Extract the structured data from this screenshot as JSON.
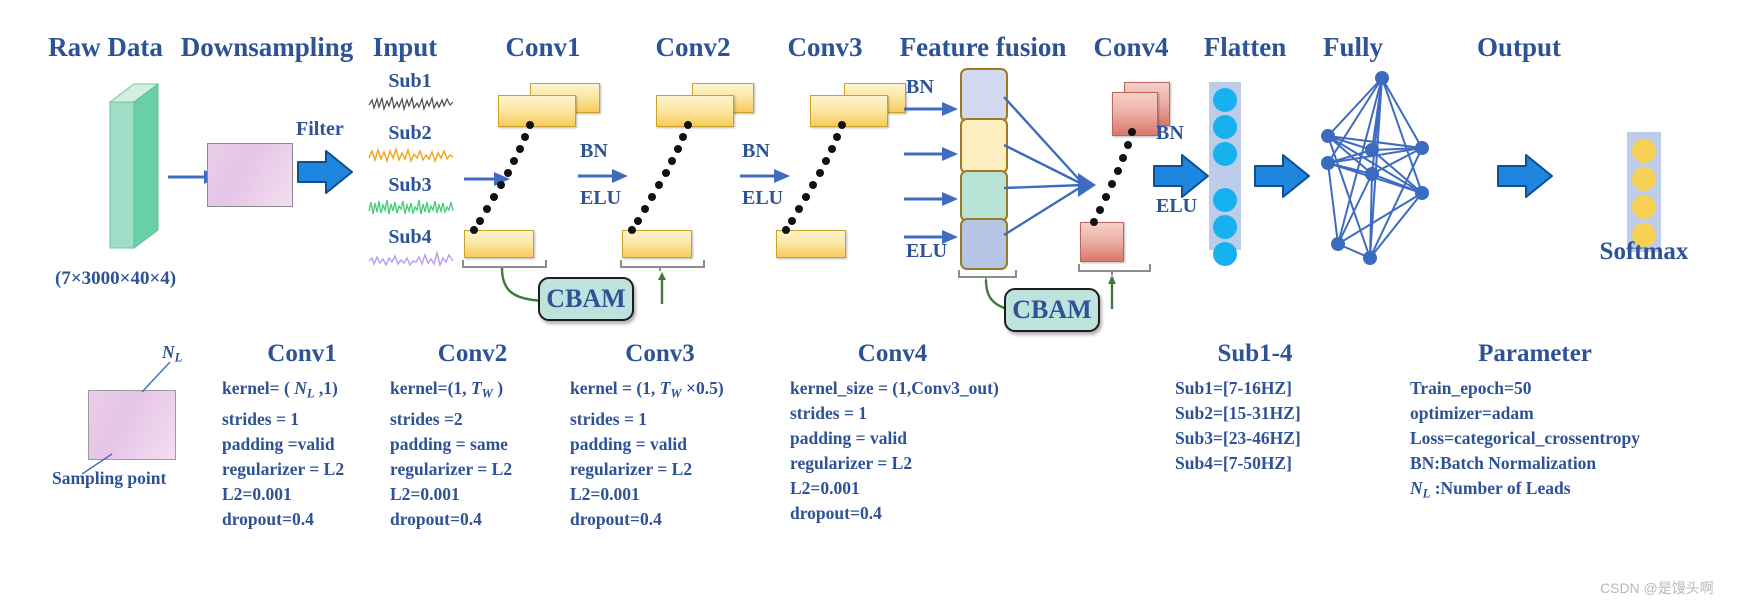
{
  "figure": {
    "title": "CNN architecture with CBAM and multi-sub-band feature fusion",
    "accent_color": "#2d5296",
    "arrow_color": "#1f86e0",
    "thin_arrow_color": "#3f6cc0"
  },
  "headers": [
    {
      "key": "raw_data",
      "label": "Raw Data"
    },
    {
      "key": "downsampling",
      "label": "Downsampling"
    },
    {
      "key": "input",
      "label": "Input"
    },
    {
      "key": "conv1",
      "label": "Conv1"
    },
    {
      "key": "conv2",
      "label": "Conv2"
    },
    {
      "key": "conv3",
      "label": "Conv3"
    },
    {
      "key": "feature_fusion",
      "label": "Feature fusion"
    },
    {
      "key": "conv4",
      "label": "Conv4"
    },
    {
      "key": "flatten",
      "label": "Flatten"
    },
    {
      "key": "fully",
      "label": "Fully"
    },
    {
      "key": "output",
      "label": "Output"
    }
  ],
  "raw_data": {
    "shape_caption": "(7×3000×40×4)"
  },
  "downsampling": {
    "filter_label": "Filter"
  },
  "input": {
    "signals": [
      {
        "label": "Sub1",
        "color": "#4a4a4a"
      },
      {
        "label": "Sub2",
        "color": "#f4a419"
      },
      {
        "label": "Sub3",
        "color": "#49d07a"
      },
      {
        "label": "Sub4",
        "color": "#b79cf0"
      }
    ]
  },
  "flow_labels": {
    "bn": "BN",
    "elu": "ELU"
  },
  "cbam": {
    "label": "CBAM"
  },
  "feature_fusion": {
    "bn": "BN",
    "elu": "ELU",
    "blocks": [
      {
        "color": "#d3d9f0"
      },
      {
        "color": "#fdeec2"
      },
      {
        "color": "#b9e3d4"
      },
      {
        "color": "#b6c4e6"
      }
    ]
  },
  "flatten": {
    "node_color": "#16b2ef",
    "column_color": "#bdcce9"
  },
  "output": {
    "node_color": "#f6d154",
    "column_color": "#bdcce9",
    "softmax_label": "Softmax"
  },
  "legend": {
    "n_l_label": "N",
    "n_l_sub": "L",
    "sampling_point_label": "Sampling point"
  },
  "param_columns": [
    {
      "key": "conv1",
      "title": "Conv1",
      "lines": [
        {
          "text": "kernel= ( ",
          "math": "N",
          "mathsub": "L",
          "tail": " ,1)"
        },
        {
          "text": "strides = 1"
        },
        {
          "text": "padding =valid"
        },
        {
          "text": "regularizer = L2"
        },
        {
          "text": "L2=0.001"
        },
        {
          "text": "dropout=0.4"
        }
      ]
    },
    {
      "key": "conv2",
      "title": "Conv2",
      "lines": [
        {
          "text": "kernel=(1, ",
          "math": "T",
          "mathsub": "W",
          "tail": " )"
        },
        {
          "text": "strides =2"
        },
        {
          "text": "padding = same"
        },
        {
          "text": "regularizer = L2"
        },
        {
          "text": "L2=0.001"
        },
        {
          "text": "dropout=0.4"
        }
      ]
    },
    {
      "key": "conv3",
      "title": "Conv3",
      "lines": [
        {
          "text": "kernel = (1, ",
          "math": "T",
          "mathsub": "W",
          "tail": " ×0.5)"
        },
        {
          "text": "strides = 1"
        },
        {
          "text": "padding = valid"
        },
        {
          "text": "regularizer = L2"
        },
        {
          "text": "L2=0.001"
        },
        {
          "text": "dropout=0.4"
        }
      ]
    },
    {
      "key": "conv4",
      "title": "Conv4",
      "lines": [
        {
          "text": "kernel_size = (1,Conv3_out)"
        },
        {
          "text": "strides = 1"
        },
        {
          "text": "padding = valid"
        },
        {
          "text": "regularizer = L2"
        },
        {
          "text": "L2=0.001"
        },
        {
          "text": "dropout=0.4"
        }
      ]
    },
    {
      "key": "sub1_4",
      "title": "Sub1-4",
      "lines": [
        {
          "text": "Sub1=[7-16HZ]"
        },
        {
          "text": "Sub2=[15-31HZ]"
        },
        {
          "text": "Sub3=[23-46HZ]"
        },
        {
          "text": "Sub4=[7-50HZ]"
        }
      ]
    },
    {
      "key": "parameter",
      "title": "Parameter",
      "lines": [
        {
          "text": "Train_epoch=50"
        },
        {
          "text": "optimizer=adam"
        },
        {
          "text": "Loss=categorical_crossentropy"
        },
        {
          "text": "BN:Batch Normalization"
        },
        {
          "text": "",
          "math": "N",
          "mathsub": "L",
          "tail": " :Number of Leads"
        }
      ]
    }
  ],
  "watermark": {
    "text": "CSDN @是馒头啊"
  }
}
